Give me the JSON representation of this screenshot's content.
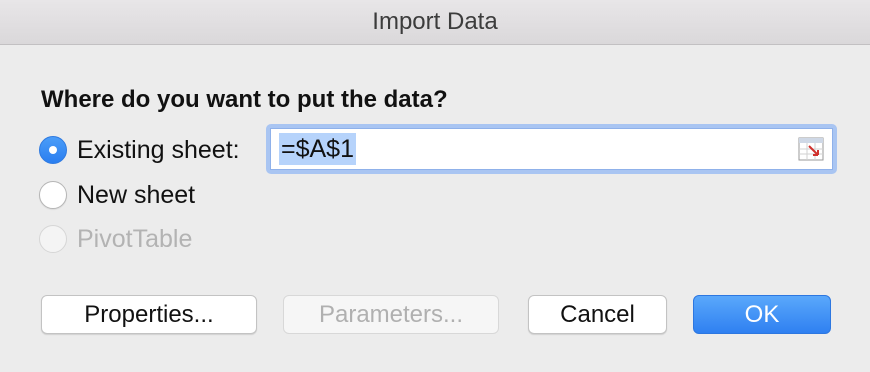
{
  "window": {
    "title": "Import Data"
  },
  "dialog": {
    "question": "Where do you want to put the data?",
    "options": [
      {
        "label": "Existing sheet:",
        "state": "selected"
      },
      {
        "label": "New sheet",
        "state": "unselected"
      },
      {
        "label": "PivotTable",
        "state": "disabled"
      }
    ],
    "location_field": {
      "value": "=$A$1",
      "icon": "collapse-dialog-icon"
    }
  },
  "buttons": {
    "properties": "Properties...",
    "parameters": "Parameters...",
    "cancel": "Cancel",
    "ok": "OK"
  },
  "colors": {
    "accent": "#2f80f1",
    "field_focus": "#a9c5f2",
    "selection": "#b6d3fb"
  }
}
